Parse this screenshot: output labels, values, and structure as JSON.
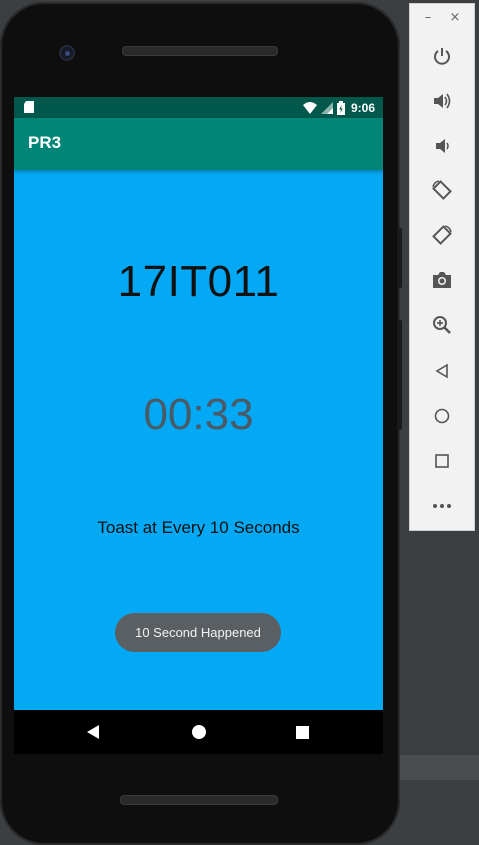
{
  "status_bar": {
    "time": "9:06"
  },
  "app_bar": {
    "title": "PR3"
  },
  "main": {
    "id_text": "17IT011",
    "timer": "00:33",
    "info_text": "Toast at Every 10 Seconds"
  },
  "toast": {
    "message": "10 Second Happened"
  },
  "emulator_panel": {
    "window_controls": [
      "minimize-icon",
      "close-icon"
    ],
    "tools": [
      "power-icon",
      "volume-up-icon",
      "volume-down-icon",
      "rotate-left-icon",
      "rotate-right-icon",
      "camera-icon",
      "zoom-icon",
      "back-icon",
      "home-icon",
      "overview-icon",
      "more-icon"
    ]
  },
  "colors": {
    "status_bar": "#00574b",
    "app_bar": "#008577",
    "background": "#03a9f4",
    "toast": "#5a5f63"
  }
}
